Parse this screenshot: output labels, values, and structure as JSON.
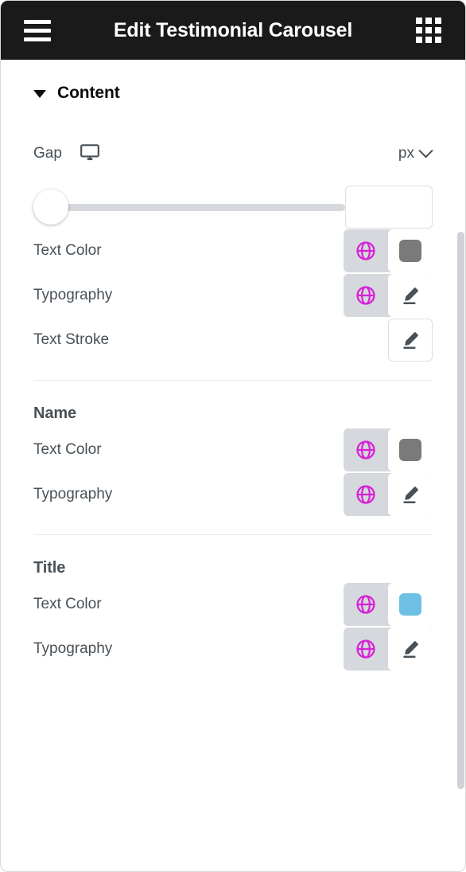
{
  "header": {
    "title": "Edit Testimonial Carousel",
    "menu_icon": "hamburger-menu-icon",
    "apps_icon": "grid-apps-icon"
  },
  "panel": {
    "section": {
      "label": "Content",
      "expanded": true,
      "caret_icon": "caret-down-icon"
    },
    "controls": [
      {
        "id": "gap",
        "label": "Gap",
        "type": "slider",
        "device_icon": "desktop-monitor-icon",
        "unit": "px",
        "unit_chevron_icon": "chevron-down-icon",
        "value": "",
        "placeholder": "",
        "slider_position_percent": 0
      },
      {
        "id": "content-text-color",
        "label": "Text Color",
        "type": "color",
        "globe_icon": "globe-icon",
        "swatch_color": "#7a7a7a"
      },
      {
        "id": "content-typography",
        "label": "Typography",
        "type": "editor",
        "globe_icon": "globe-icon",
        "edit_icon": "pencil-edit-icon"
      },
      {
        "id": "content-text-stroke",
        "label": "Text Stroke",
        "type": "editor-only",
        "edit_icon": "pencil-edit-icon"
      }
    ],
    "groups": [
      {
        "heading": "Name",
        "controls": [
          {
            "id": "name-text-color",
            "label": "Text Color",
            "type": "color",
            "globe_icon": "globe-icon",
            "swatch_color": "#7a7a7a"
          },
          {
            "id": "name-typography",
            "label": "Typography",
            "type": "editor",
            "globe_icon": "globe-icon",
            "edit_icon": "pencil-edit-icon"
          }
        ]
      },
      {
        "heading": "Title",
        "controls": [
          {
            "id": "title-text-color",
            "label": "Text Color",
            "type": "color",
            "globe_icon": "globe-icon",
            "swatch_color": "#6ec1e4"
          },
          {
            "id": "title-typography",
            "label": "Typography",
            "type": "editor",
            "globe_icon": "globe-icon",
            "edit_icon": "pencil-edit-icon"
          }
        ]
      }
    ]
  },
  "colors": {
    "header_bg": "#1a1a1a",
    "globe_accent": "#d721d7",
    "label_text": "#495157",
    "control_group_bg": "#d5d8dc",
    "divider": "#e6e9ec"
  }
}
